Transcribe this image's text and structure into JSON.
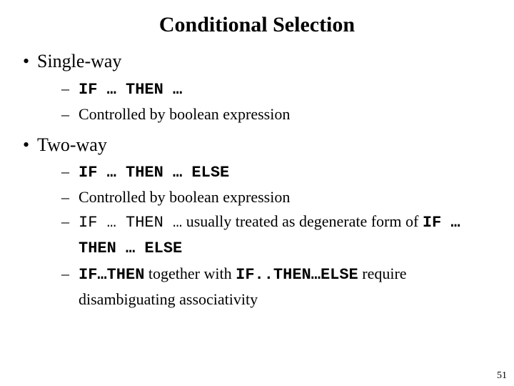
{
  "title": "Conditional Selection",
  "bullets": [
    {
      "label": "Single-way",
      "sub": [
        {
          "parts": [
            {
              "t": "IF … THEN …",
              "cls": "mono"
            }
          ]
        },
        {
          "parts": [
            {
              "t": "Controlled by boolean expression",
              "cls": ""
            }
          ]
        }
      ]
    },
    {
      "label": "Two-way",
      "sub": [
        {
          "parts": [
            {
              "t": "IF … THEN … ELSE",
              "cls": "mono"
            }
          ]
        },
        {
          "parts": [
            {
              "t": "Controlled by boolean expression",
              "cls": ""
            }
          ]
        },
        {
          "parts": [
            {
              "t": "IF … THEN …",
              "cls": "mono-plain"
            },
            {
              "t": " usually treated as degenerate form of ",
              "cls": ""
            },
            {
              "t": "IF … THEN … ELSE",
              "cls": "mono"
            }
          ]
        },
        {
          "parts": [
            {
              "t": "IF…THEN",
              "cls": "mono"
            },
            {
              "t": " together with ",
              "cls": ""
            },
            {
              "t": "IF..THEN…ELSE",
              "cls": "mono"
            },
            {
              "t": " require disambiguating associativity",
              "cls": ""
            }
          ]
        }
      ]
    }
  ],
  "page_number": "51"
}
